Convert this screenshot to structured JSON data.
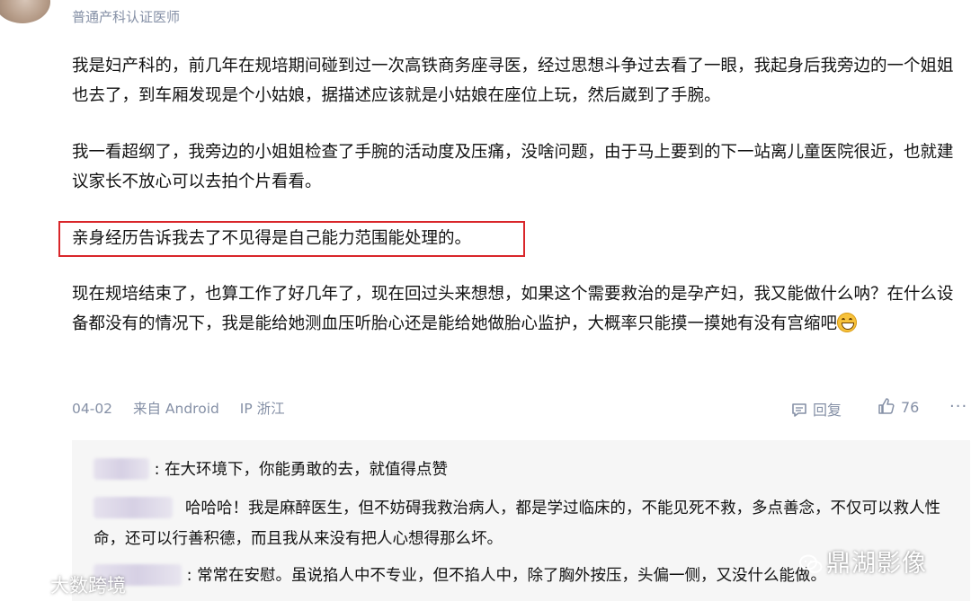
{
  "author": {
    "badge": "普通产科认证医师"
  },
  "answer": {
    "paragraphs": [
      "我是妇产科的，前几年在规培期间碰到过一次高铁商务座寻医，经过思想斗争过去看了一眼，我起身后我旁边的一个姐姐也去了，到车厢发现是个小姑娘，据描述应该就是小姑娘在座位上玩，然后崴到了手腕。",
      "我一看超纲了，我旁边的小姐姐检查了手腕的活动度及压痛，没啥问题，由于马上要到的下一站离儿童医院很近，也就建议家长不放心可以去拍个片看看。",
      "亲身经历告诉我去了不见得是自己能力范围能处理的。",
      "现在规培结束了，也算工作了好几年了，现在回过头来想想，如果这个需要救治的是孕产妇，我又能做什么呐？在什么设备都没有的情况下，我是能给她测血压听胎心还是能给她做胎心监护，大概率只能摸一摸她有没有宫缩吧"
    ],
    "emoji": "grinning-face-emoji"
  },
  "meta": {
    "date": "04-02",
    "source": "来自 Android",
    "ip": "IP 浙江"
  },
  "actions": {
    "reply_label": "回复",
    "like_count": "76"
  },
  "comments": [
    {
      "text": "在大环境下，你能勇敢的去，就值得点赞",
      "prefix": ":"
    },
    {
      "text": "哈哈哈！我是麻醉医生，但不妨碍我救治病人，都是学过临床的，不能见死不救，多点善念，不仅可以救人性命，还可以行善积德，而且我从来没有把人心想得那么坏。",
      "prefix": ""
    },
    {
      "text": "常常在安慰。虽说掐人中不专业，但不掐人中，除了胸外按压，头偏一侧，又没什么能做。",
      "prefix": ":"
    }
  ],
  "watermarks": {
    "right": "鼎湖影像",
    "left": "大数跨境"
  },
  "colors": {
    "highlight_border": "#d9262a",
    "meta_text": "#8590a6",
    "comment_bg": "#f6f6f6"
  }
}
